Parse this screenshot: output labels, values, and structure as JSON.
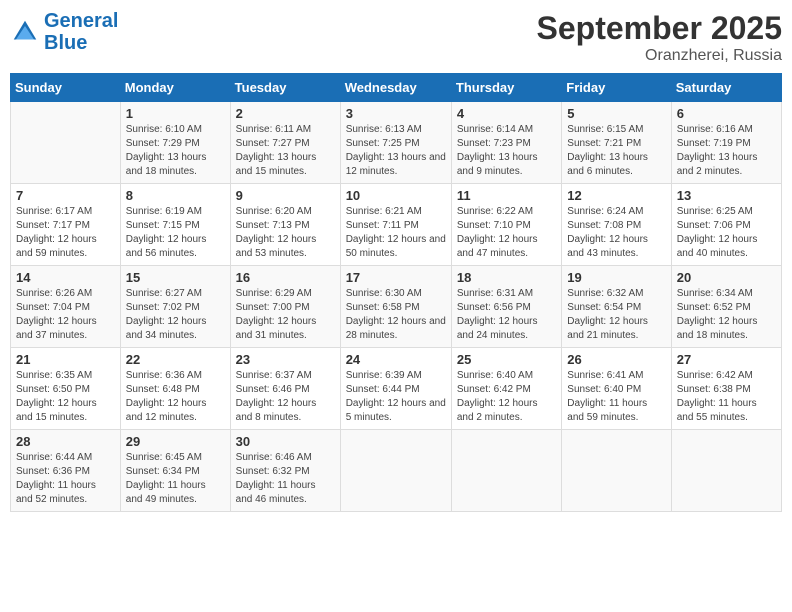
{
  "header": {
    "logo_general": "General",
    "logo_blue": "Blue",
    "month_year": "September 2025",
    "location": "Oranzherei, Russia"
  },
  "days_of_week": [
    "Sunday",
    "Monday",
    "Tuesday",
    "Wednesday",
    "Thursday",
    "Friday",
    "Saturday"
  ],
  "weeks": [
    [
      {
        "day": "",
        "sunrise": "",
        "sunset": "",
        "daylight": ""
      },
      {
        "day": "1",
        "sunrise": "Sunrise: 6:10 AM",
        "sunset": "Sunset: 7:29 PM",
        "daylight": "Daylight: 13 hours and 18 minutes."
      },
      {
        "day": "2",
        "sunrise": "Sunrise: 6:11 AM",
        "sunset": "Sunset: 7:27 PM",
        "daylight": "Daylight: 13 hours and 15 minutes."
      },
      {
        "day": "3",
        "sunrise": "Sunrise: 6:13 AM",
        "sunset": "Sunset: 7:25 PM",
        "daylight": "Daylight: 13 hours and 12 minutes."
      },
      {
        "day": "4",
        "sunrise": "Sunrise: 6:14 AM",
        "sunset": "Sunset: 7:23 PM",
        "daylight": "Daylight: 13 hours and 9 minutes."
      },
      {
        "day": "5",
        "sunrise": "Sunrise: 6:15 AM",
        "sunset": "Sunset: 7:21 PM",
        "daylight": "Daylight: 13 hours and 6 minutes."
      },
      {
        "day": "6",
        "sunrise": "Sunrise: 6:16 AM",
        "sunset": "Sunset: 7:19 PM",
        "daylight": "Daylight: 13 hours and 2 minutes."
      }
    ],
    [
      {
        "day": "7",
        "sunrise": "Sunrise: 6:17 AM",
        "sunset": "Sunset: 7:17 PM",
        "daylight": "Daylight: 12 hours and 59 minutes."
      },
      {
        "day": "8",
        "sunrise": "Sunrise: 6:19 AM",
        "sunset": "Sunset: 7:15 PM",
        "daylight": "Daylight: 12 hours and 56 minutes."
      },
      {
        "day": "9",
        "sunrise": "Sunrise: 6:20 AM",
        "sunset": "Sunset: 7:13 PM",
        "daylight": "Daylight: 12 hours and 53 minutes."
      },
      {
        "day": "10",
        "sunrise": "Sunrise: 6:21 AM",
        "sunset": "Sunset: 7:11 PM",
        "daylight": "Daylight: 12 hours and 50 minutes."
      },
      {
        "day": "11",
        "sunrise": "Sunrise: 6:22 AM",
        "sunset": "Sunset: 7:10 PM",
        "daylight": "Daylight: 12 hours and 47 minutes."
      },
      {
        "day": "12",
        "sunrise": "Sunrise: 6:24 AM",
        "sunset": "Sunset: 7:08 PM",
        "daylight": "Daylight: 12 hours and 43 minutes."
      },
      {
        "day": "13",
        "sunrise": "Sunrise: 6:25 AM",
        "sunset": "Sunset: 7:06 PM",
        "daylight": "Daylight: 12 hours and 40 minutes."
      }
    ],
    [
      {
        "day": "14",
        "sunrise": "Sunrise: 6:26 AM",
        "sunset": "Sunset: 7:04 PM",
        "daylight": "Daylight: 12 hours and 37 minutes."
      },
      {
        "day": "15",
        "sunrise": "Sunrise: 6:27 AM",
        "sunset": "Sunset: 7:02 PM",
        "daylight": "Daylight: 12 hours and 34 minutes."
      },
      {
        "day": "16",
        "sunrise": "Sunrise: 6:29 AM",
        "sunset": "Sunset: 7:00 PM",
        "daylight": "Daylight: 12 hours and 31 minutes."
      },
      {
        "day": "17",
        "sunrise": "Sunrise: 6:30 AM",
        "sunset": "Sunset: 6:58 PM",
        "daylight": "Daylight: 12 hours and 28 minutes."
      },
      {
        "day": "18",
        "sunrise": "Sunrise: 6:31 AM",
        "sunset": "Sunset: 6:56 PM",
        "daylight": "Daylight: 12 hours and 24 minutes."
      },
      {
        "day": "19",
        "sunrise": "Sunrise: 6:32 AM",
        "sunset": "Sunset: 6:54 PM",
        "daylight": "Daylight: 12 hours and 21 minutes."
      },
      {
        "day": "20",
        "sunrise": "Sunrise: 6:34 AM",
        "sunset": "Sunset: 6:52 PM",
        "daylight": "Daylight: 12 hours and 18 minutes."
      }
    ],
    [
      {
        "day": "21",
        "sunrise": "Sunrise: 6:35 AM",
        "sunset": "Sunset: 6:50 PM",
        "daylight": "Daylight: 12 hours and 15 minutes."
      },
      {
        "day": "22",
        "sunrise": "Sunrise: 6:36 AM",
        "sunset": "Sunset: 6:48 PM",
        "daylight": "Daylight: 12 hours and 12 minutes."
      },
      {
        "day": "23",
        "sunrise": "Sunrise: 6:37 AM",
        "sunset": "Sunset: 6:46 PM",
        "daylight": "Daylight: 12 hours and 8 minutes."
      },
      {
        "day": "24",
        "sunrise": "Sunrise: 6:39 AM",
        "sunset": "Sunset: 6:44 PM",
        "daylight": "Daylight: 12 hours and 5 minutes."
      },
      {
        "day": "25",
        "sunrise": "Sunrise: 6:40 AM",
        "sunset": "Sunset: 6:42 PM",
        "daylight": "Daylight: 12 hours and 2 minutes."
      },
      {
        "day": "26",
        "sunrise": "Sunrise: 6:41 AM",
        "sunset": "Sunset: 6:40 PM",
        "daylight": "Daylight: 11 hours and 59 minutes."
      },
      {
        "day": "27",
        "sunrise": "Sunrise: 6:42 AM",
        "sunset": "Sunset: 6:38 PM",
        "daylight": "Daylight: 11 hours and 55 minutes."
      }
    ],
    [
      {
        "day": "28",
        "sunrise": "Sunrise: 6:44 AM",
        "sunset": "Sunset: 6:36 PM",
        "daylight": "Daylight: 11 hours and 52 minutes."
      },
      {
        "day": "29",
        "sunrise": "Sunrise: 6:45 AM",
        "sunset": "Sunset: 6:34 PM",
        "daylight": "Daylight: 11 hours and 49 minutes."
      },
      {
        "day": "30",
        "sunrise": "Sunrise: 6:46 AM",
        "sunset": "Sunset: 6:32 PM",
        "daylight": "Daylight: 11 hours and 46 minutes."
      },
      {
        "day": "",
        "sunrise": "",
        "sunset": "",
        "daylight": ""
      },
      {
        "day": "",
        "sunrise": "",
        "sunset": "",
        "daylight": ""
      },
      {
        "day": "",
        "sunrise": "",
        "sunset": "",
        "daylight": ""
      },
      {
        "day": "",
        "sunrise": "",
        "sunset": "",
        "daylight": ""
      }
    ]
  ]
}
